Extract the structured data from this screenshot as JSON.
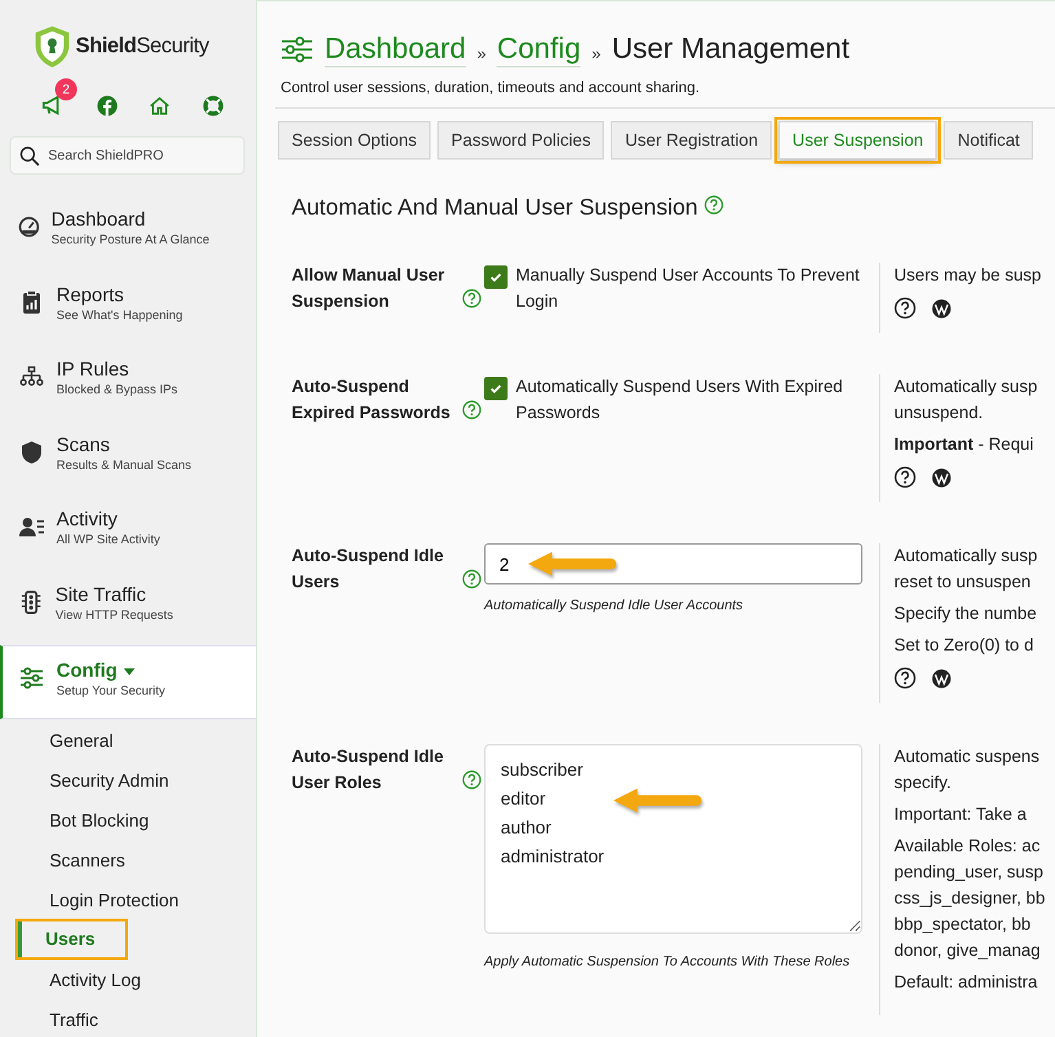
{
  "logo": {
    "bold": "Shield",
    "rest": "Security"
  },
  "quick_links": {
    "badge": "2"
  },
  "search": {
    "placeholder": "Search ShieldPRO"
  },
  "nav": [
    {
      "title": "Dashboard",
      "subtitle": "Security Posture At A Glance",
      "selected": false
    },
    {
      "title": "Reports",
      "subtitle": "See What's Happening",
      "selected": false
    },
    {
      "title": "IP Rules",
      "subtitle": "Blocked & Bypass IPs",
      "selected": false
    },
    {
      "title": "Scans",
      "subtitle": "Results & Manual Scans",
      "selected": false
    },
    {
      "title": "Activity",
      "subtitle": "All WP Site Activity",
      "selected": false
    },
    {
      "title": "Site Traffic",
      "subtitle": "View HTTP Requests",
      "selected": false
    },
    {
      "title": "Config",
      "subtitle": "Setup Your Security",
      "selected": true,
      "expanded": true
    }
  ],
  "submenu": [
    {
      "label": "General",
      "selected": false,
      "highlighted": false
    },
    {
      "label": "Security Admin",
      "selected": false,
      "highlighted": false
    },
    {
      "label": "Bot Blocking",
      "selected": false,
      "highlighted": false
    },
    {
      "label": "Scanners",
      "selected": false,
      "highlighted": false
    },
    {
      "label": "Login Protection",
      "selected": false,
      "highlighted": false
    },
    {
      "label": "Users",
      "selected": true,
      "highlighted": true
    },
    {
      "label": "Activity Log",
      "selected": false,
      "highlighted": false
    },
    {
      "label": "Traffic",
      "selected": false,
      "highlighted": false
    }
  ],
  "breadcrumb": [
    {
      "label": "Dashboard",
      "kind": "link"
    },
    {
      "label": "Config",
      "kind": "link"
    },
    {
      "label": "User Management",
      "kind": "current"
    }
  ],
  "breadcrumb_separator": "»",
  "description": "Control user sessions, duration, timeouts and account sharing.",
  "tabs": [
    {
      "label": "Session Options",
      "selected": false,
      "highlighted": false
    },
    {
      "label": "Password Policies",
      "selected": false,
      "highlighted": false
    },
    {
      "label": "User Registration",
      "selected": false,
      "highlighted": false
    },
    {
      "label": "User Suspension",
      "selected": true,
      "highlighted": true
    },
    {
      "label": "Notificat",
      "selected": false,
      "highlighted": false
    }
  ],
  "section": {
    "title": "Automatic And Manual User Suspension"
  },
  "options": [
    {
      "label": "Allow Manual User Suspension",
      "kind": "checkbox",
      "checked": true,
      "text": "Manually Suspend User Accounts To Prevent Login",
      "details": [
        "Users may be susp"
      ],
      "links": true,
      "arrow": false
    },
    {
      "label": "Auto-Suspend Expired Passwords",
      "kind": "checkbox",
      "checked": true,
      "text": "Automatically Suspend Users With Expired Passwords",
      "details": [
        "Automatically susp\nunsuspend.",
        "**Important** - Requi"
      ],
      "links": true,
      "arrow": false
    },
    {
      "label": "Auto-Suspend Idle Users",
      "kind": "text",
      "value": "2",
      "help": "Automatically Suspend Idle User Accounts",
      "details": [
        "Automatically susp\nreset to unsuspen",
        "Specify the numbe",
        "Set to Zero(0) to d"
      ],
      "links": true,
      "arrow": true
    },
    {
      "label": "Auto-Suspend Idle User Roles",
      "kind": "textarea",
      "value": "subscriber\neditor\nauthor\nadministrator",
      "help": "Apply Automatic Suspension To Accounts With These Roles",
      "details": [
        "Automatic suspens\nspecify.",
        "Important: Take a",
        "Available Roles: ac\npending_user, susp\ncss_js_designer, bb\nbbp_spectator, bb\ndonor, give_manag",
        "Default: administra"
      ],
      "links": false,
      "arrow": true
    }
  ]
}
